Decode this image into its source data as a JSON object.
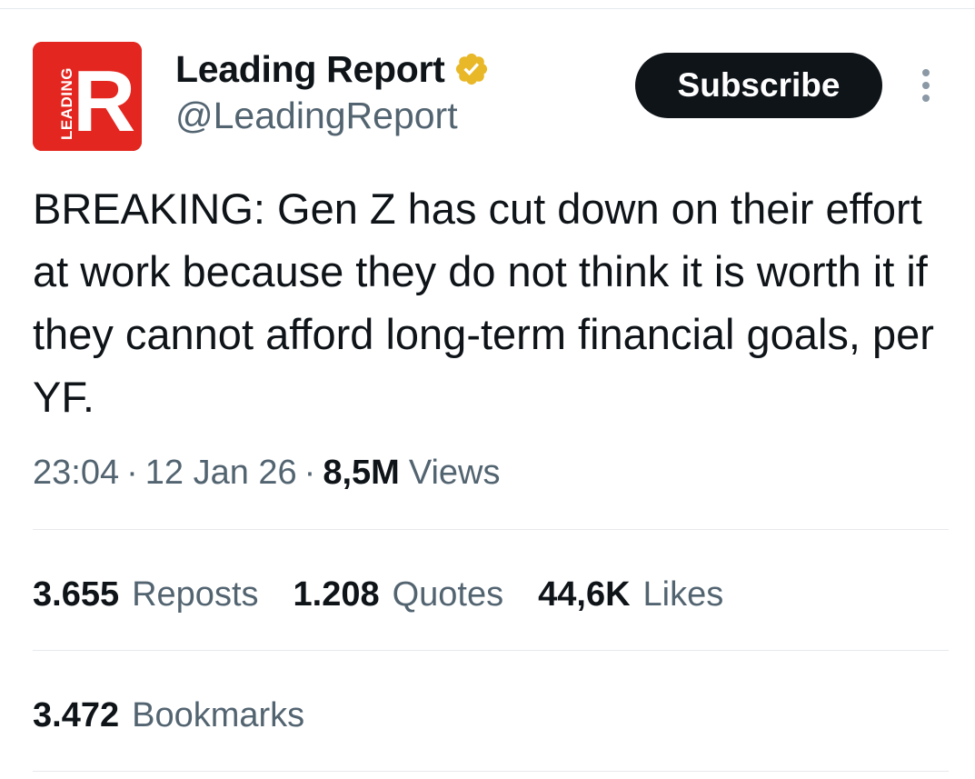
{
  "author": {
    "name": "Leading Report",
    "handle": "@LeadingReport",
    "avatar_logo_text": "LEADING R",
    "verified": true
  },
  "subscribe_label": "Subscribe",
  "tweet": {
    "text": "BREAKING: Gen Z has cut down on their effort at work because they do not think it is worth it if they cannot afford long-term financial goals, per YF.",
    "time": "23:04",
    "date": "12 Jan 26",
    "separator": "·",
    "views_count": "8,5M",
    "views_label": "Views"
  },
  "stats": {
    "reposts": {
      "count": "3.655",
      "label": "Reposts"
    },
    "quotes": {
      "count": "1.208",
      "label": "Quotes"
    },
    "likes": {
      "count": "44,6K",
      "label": "Likes"
    },
    "bookmarks": {
      "count": "3.472",
      "label": "Bookmarks"
    }
  },
  "colors": {
    "avatar_bg": "#e3261f",
    "text_primary": "#0f1419",
    "text_secondary": "#536471",
    "verified_gold": "#e8b829",
    "button_bg": "#0f1419",
    "divider": "#e6e9ec"
  },
  "icons": {
    "verified": "verified-badge-icon",
    "more": "more-vertical-icon"
  }
}
